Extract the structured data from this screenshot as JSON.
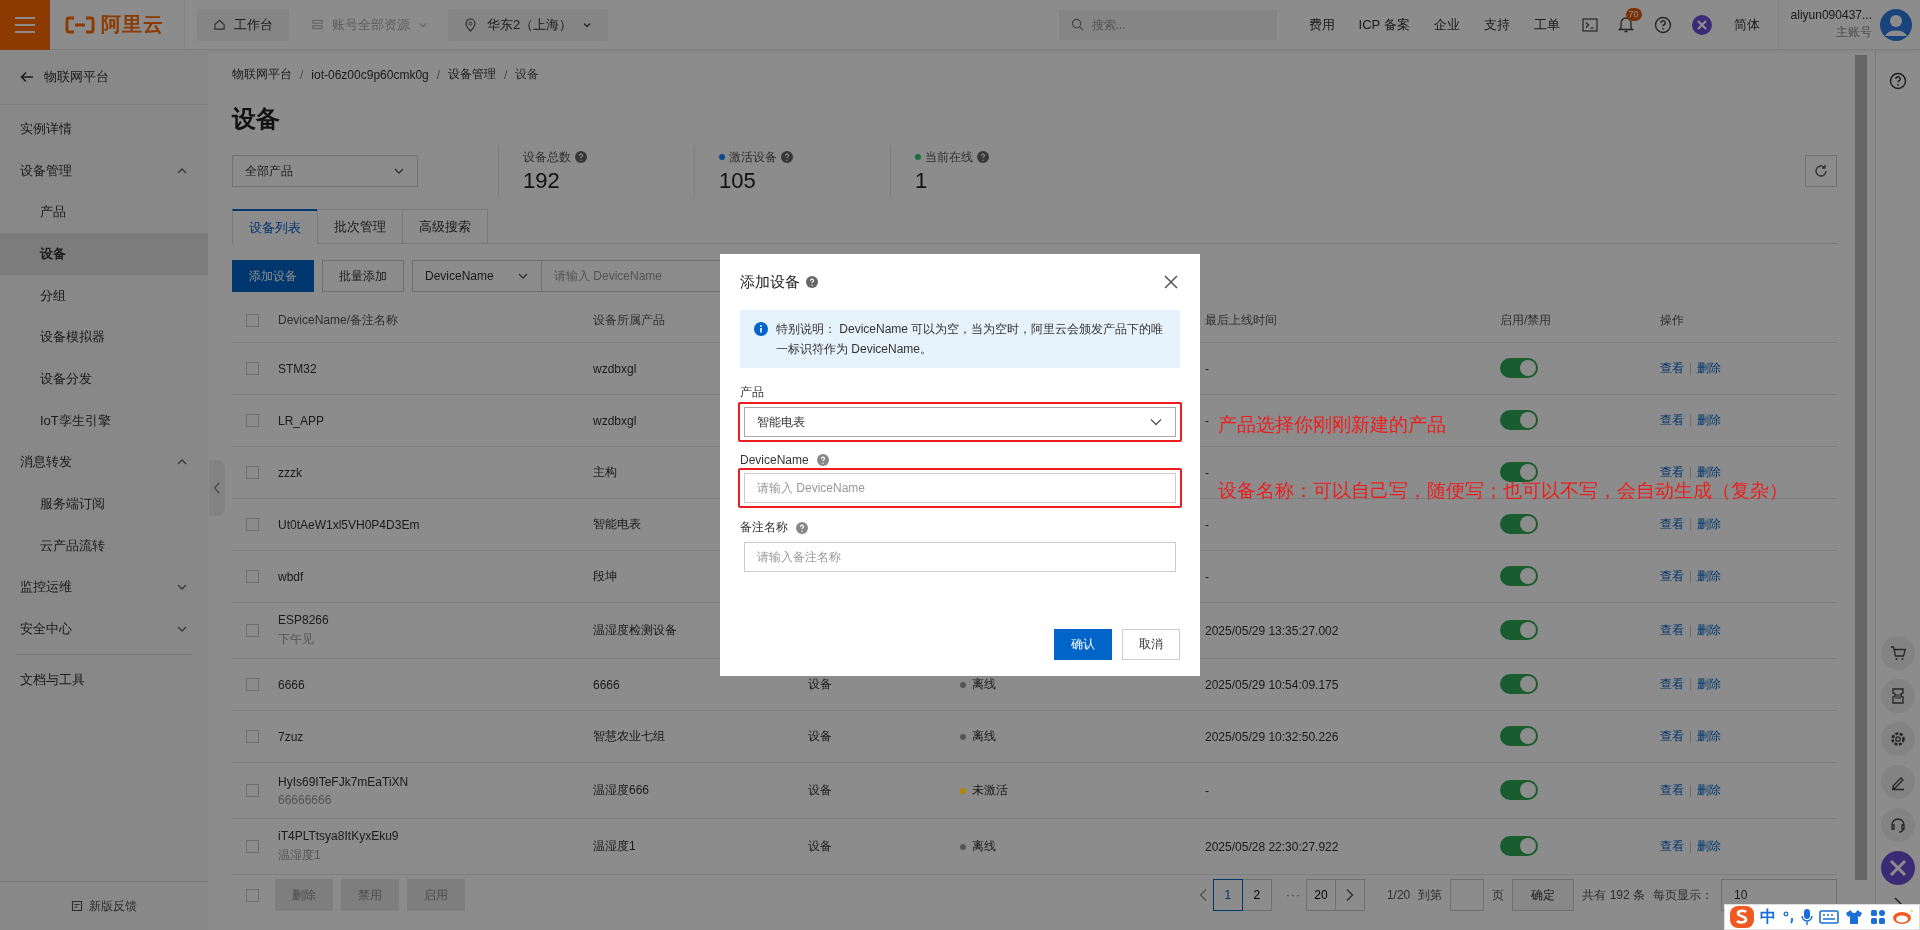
{
  "topbar": {
    "logo": "阿里云",
    "workbench": "工作台",
    "resources": "账号全部资源",
    "region": "华东2（上海）",
    "search": {
      "placeholder": "搜索..."
    },
    "links": [
      "费用",
      "ICP 备案",
      "企业",
      "支持",
      "工单"
    ],
    "notification_count": "70",
    "language": "简体",
    "account": "aliyun090437...",
    "account_role": "主账号"
  },
  "sidebar": {
    "back": "物联网平台",
    "items": [
      {
        "label": "实例详情",
        "selected": false
      },
      {
        "label": "设备管理",
        "selected": false,
        "expanded": true,
        "children": [
          {
            "label": "产品",
            "selected": false
          },
          {
            "label": "设备",
            "selected": true
          },
          {
            "label": "分组",
            "selected": false
          },
          {
            "label": "设备模拟器",
            "selected": false
          },
          {
            "label": "设备分发",
            "selected": false
          },
          {
            "label": "IoT孪生引擎",
            "selected": false
          }
        ]
      },
      {
        "label": "消息转发",
        "selected": false,
        "expanded": true,
        "children": [
          {
            "label": "服务端订阅",
            "selected": false
          },
          {
            "label": "云产品流转",
            "selected": false
          }
        ]
      },
      {
        "label": "监控运维",
        "selected": false,
        "expanded": false
      },
      {
        "label": "安全中心",
        "selected": false,
        "expanded": false
      },
      {
        "label": "文档与工具",
        "selected": false
      }
    ],
    "feedback": "新版反馈"
  },
  "breadcrumb": [
    "物联网平台",
    "iot-06z00c9p60cmk0g",
    "设备管理",
    "设备"
  ],
  "breadcrumb_separator": "/",
  "title": "设备",
  "product_filter": "全部产品",
  "stats": [
    {
      "label": "设备总数",
      "value": "192"
    },
    {
      "label": "激活设备",
      "value": "105",
      "color": "#0b4a8c"
    },
    {
      "label": "当前在线",
      "value": "1",
      "color": "#17703a"
    }
  ],
  "tabs": [
    {
      "label": "设备列表",
      "selected": true
    },
    {
      "label": "批次管理",
      "selected": false
    },
    {
      "label": "高级搜索",
      "selected": false
    }
  ],
  "toolbar": {
    "add": "添加设备",
    "batch_add": "批量添加",
    "search_field": "DeviceName",
    "search_placeholder": "请输入 DeviceName"
  },
  "table": {
    "select_all_checked": false,
    "columns": [
      {
        "kind": "name",
        "label": "DeviceName/备注名称"
      },
      {
        "kind": "product",
        "label": "设备所属产品"
      },
      {
        "kind": "time",
        "label": "最后上线时间"
      },
      {
        "kind": "switch",
        "label": "启用/禁用"
      },
      {
        "kind": "actions",
        "label": "操作"
      }
    ],
    "rows": [
      {
        "checked": false,
        "name": "STM32",
        "product": "wzdbxgl",
        "last_online": "-",
        "enabled": true,
        "actions": [
          "查看",
          "删除"
        ]
      },
      {
        "checked": false,
        "name": "LR_APP",
        "product": "wzdbxgl",
        "last_online": "-",
        "enabled": true,
        "actions": [
          "查看",
          "删除"
        ]
      },
      {
        "checked": false,
        "name": "zzzk",
        "product": "主构",
        "last_online": "-",
        "enabled": true,
        "actions": [
          "查看",
          "删除"
        ]
      },
      {
        "checked": false,
        "name": "Ut0tAeW1xl5VH0P4D3Em",
        "product": "智能电表",
        "last_online": "-",
        "enabled": true,
        "actions": [
          "查看",
          "删除"
        ]
      },
      {
        "checked": false,
        "name": "wbdf",
        "product": "段坤",
        "last_online": "-",
        "enabled": true,
        "actions": [
          "查看",
          "删除"
        ]
      },
      {
        "checked": false,
        "name": "ESP8266",
        "note": "下午见",
        "product": "温湿度检测设备",
        "last_online": "2025/05/29 13:35:27.002",
        "enabled": true,
        "actions": [
          "查看",
          "删除"
        ]
      },
      {
        "checked": false,
        "name": "6666",
        "product": "6666",
        "node_type": "设备",
        "status": {
          "label": "离线",
          "color": "#555555"
        },
        "last_online": "2025/05/29 10:54:09.175",
        "enabled": true,
        "actions": [
          "查看",
          "删除"
        ]
      },
      {
        "checked": false,
        "name": "7zuz",
        "product": "智慧农业七组",
        "node_type": "设备",
        "status": {
          "label": "离线",
          "color": "#555555"
        },
        "last_online": "2025/05/29 10:32:50.226",
        "enabled": true,
        "actions": [
          "查看",
          "删除"
        ]
      },
      {
        "checked": false,
        "name": "HyIs69ITeFJk7mEaTiXN",
        "note": "66666666",
        "product": "温湿度666",
        "node_type": "设备",
        "status": {
          "label": "未激活",
          "color": "#b38600"
        },
        "last_online": "-",
        "enabled": true,
        "actions": [
          "查看",
          "删除"
        ]
      },
      {
        "checked": false,
        "name": "iT4PLTtsya8ItKyxEku9",
        "note": "温湿度1",
        "product": "温湿度1",
        "node_type": "设备",
        "status": {
          "label": "离线",
          "color": "#555555"
        },
        "last_online": "2025/05/28 22:30:27.922",
        "enabled": true,
        "actions": [
          "查看",
          "删除"
        ]
      }
    ]
  },
  "bulk_select_checked": false,
  "bulk_actions": [
    {
      "label": "删除",
      "disabled": true
    },
    {
      "label": "禁用",
      "disabled": true
    },
    {
      "label": "启用",
      "disabled": true
    }
  ],
  "pagination": {
    "pages": [
      {
        "kind": "page",
        "label": "1",
        "selected": true
      },
      {
        "kind": "page",
        "label": "2",
        "selected": false
      },
      {
        "kind": "ellipsis",
        "label": "···",
        "selected": false
      },
      {
        "kind": "page",
        "label": "20",
        "selected": false
      }
    ],
    "page_info": "1/20",
    "goto_label": "到第",
    "goto_suffix": "页",
    "goto_button": "确定",
    "total": "共有 192 条",
    "page_size_label": "每页显示：",
    "page_size": "10"
  },
  "modal": {
    "title": "添加设备",
    "notice": "特别说明： DeviceName 可以为空，当为空时，阿里云会颁发产品下的唯一标识符作为 DeviceName。",
    "fields": [
      {
        "kind": "select",
        "label": "产品",
        "value": "智能电表",
        "help": false,
        "highlighted": true,
        "annotation": "产品选择你刚刚新建的产品"
      },
      {
        "kind": "input",
        "label": "DeviceName",
        "placeholder": "请输入 DeviceName",
        "help": true,
        "highlighted": true,
        "annotation": "设备名称：可以自己写，随便写；也可以不写，会自动生成（复杂）"
      },
      {
        "kind": "input",
        "label": "备注名称",
        "placeholder": "请输入备注名称",
        "help": true,
        "highlighted": false
      }
    ],
    "buttons": [
      {
        "label": "确认",
        "primary": true
      },
      {
        "label": "取消",
        "primary": false
      }
    ]
  },
  "ime_bar": {
    "mode": "中"
  }
}
